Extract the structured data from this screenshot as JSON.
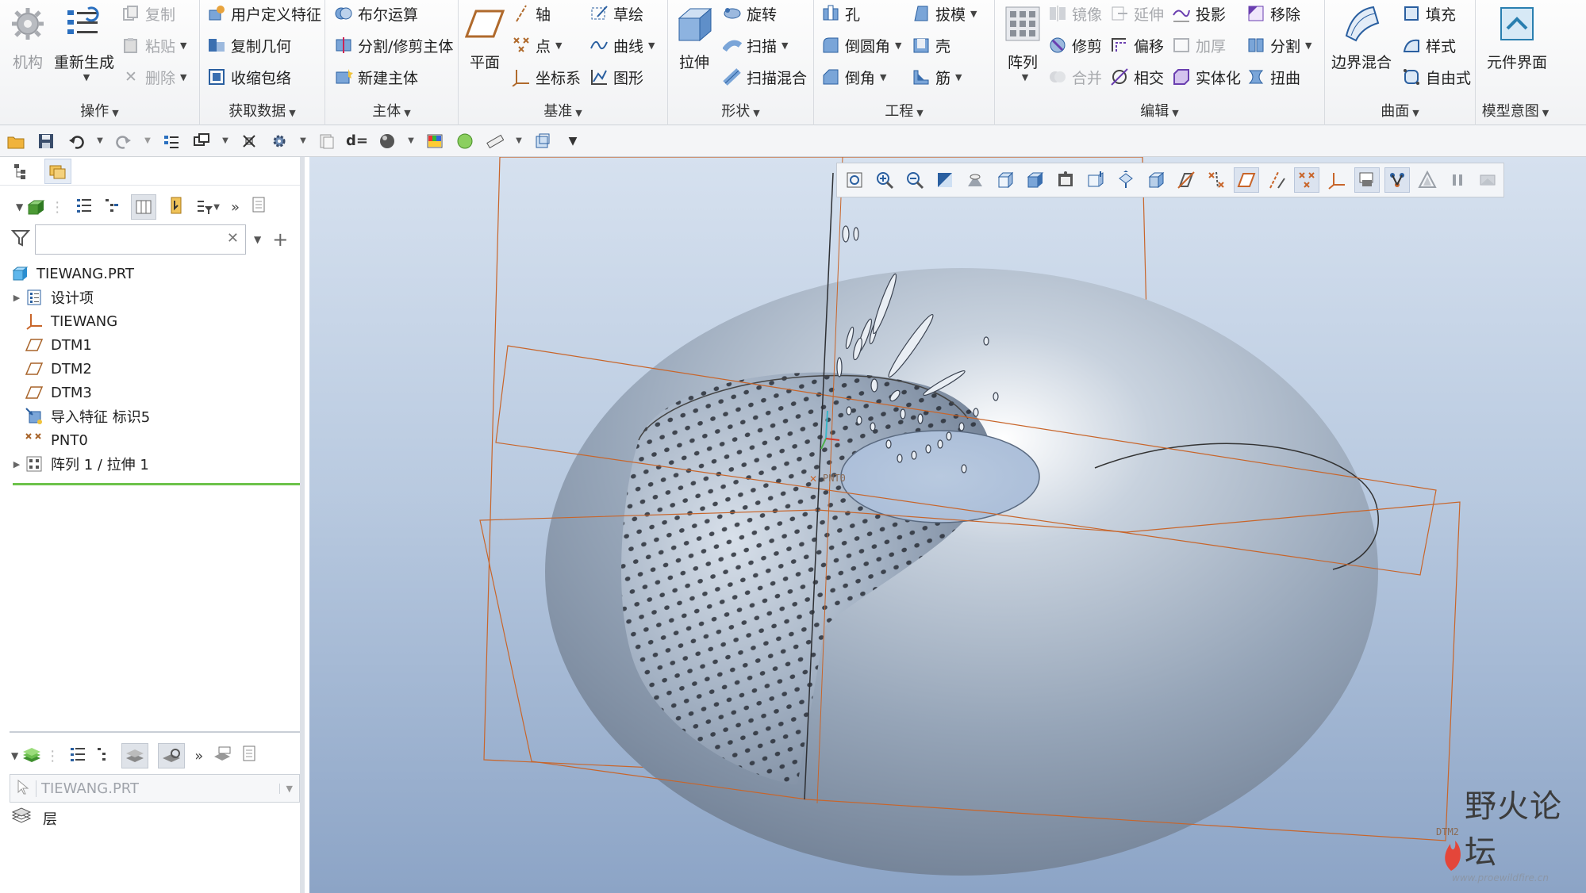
{
  "ribbon": {
    "operations": {
      "label": "操作",
      "mechanism": "机构",
      "regenerate": "重新生成",
      "copy": "复制",
      "paste": "粘贴",
      "delete": "删除"
    },
    "get_data": {
      "label": "获取数据",
      "udf": "用户定义特征",
      "copy_geom": "复制几何",
      "shrinkwrap": "收缩包络"
    },
    "body": {
      "label": "主体",
      "boolean": "布尔运算",
      "split_trim": "分割/修剪主体",
      "new_body": "新建主体"
    },
    "datum": {
      "label": "基准",
      "plane": "平面",
      "axis": "轴",
      "point": "点",
      "csys": "坐标系",
      "sketch": "草绘",
      "curve": "曲线",
      "graph": "图形"
    },
    "shapes": {
      "label": "形状",
      "extrude": "拉伸",
      "revolve": "旋转",
      "sweep": "扫描",
      "swept_blend": "扫描混合"
    },
    "engineering": {
      "label": "工程",
      "hole": "孔",
      "round": "倒圆角",
      "chamfer": "倒角",
      "draft": "拔模",
      "shell": "壳",
      "rib": "筋"
    },
    "editing": {
      "label": "编辑",
      "pattern": "阵列",
      "mirror": "镜像",
      "extend": "延伸",
      "project": "投影",
      "remove": "移除",
      "trim": "修剪",
      "offset": "偏移",
      "thicken": "加厚",
      "split": "分割",
      "merge": "合并",
      "intersect": "相交",
      "solidify": "实体化",
      "twist": "扭曲"
    },
    "surfaces": {
      "label": "曲面",
      "boundary_blend": "边界混合",
      "fill": "填充",
      "style": "样式",
      "freestyle": "自由式"
    },
    "model_intent": {
      "label": "模型意图",
      "component_interface": "元件界面"
    }
  },
  "model_tree": {
    "root": "TIEWANG.PRT",
    "items": [
      {
        "label": "设计项",
        "icon": "design-items-icon",
        "expandable": true
      },
      {
        "label": "TIEWANG",
        "icon": "csys-icon",
        "expandable": false
      },
      {
        "label": "DTM1",
        "icon": "datum-plane-icon",
        "expandable": false
      },
      {
        "label": "DTM2",
        "icon": "datum-plane-icon",
        "expandable": false
      },
      {
        "label": "DTM3",
        "icon": "datum-plane-icon",
        "expandable": false
      },
      {
        "label": "导入特征 标识5",
        "icon": "import-feature-icon",
        "expandable": false
      },
      {
        "label": "PNT0",
        "icon": "datum-point-icon",
        "expandable": false
      },
      {
        "label": "阵列 1 / 拉伸 1",
        "icon": "pattern-icon",
        "expandable": true
      }
    ]
  },
  "search": {
    "placeholder": ""
  },
  "layer_panel": {
    "selection": "TIEWANG.PRT",
    "layers_label": "层"
  },
  "viewport": {
    "point_label": "PNT0",
    "plane_label": "DTM2"
  },
  "watermark": {
    "text": "野火论坛",
    "url": "www.proewildfire.cn"
  },
  "colors": {
    "accent": "#2f7fd0",
    "datum": "#c8652a",
    "model": "#a9b6c8",
    "background_top": "#d6e1ef",
    "background_bottom": "#8ca4c6",
    "tree_underline": "#6cc24a"
  }
}
